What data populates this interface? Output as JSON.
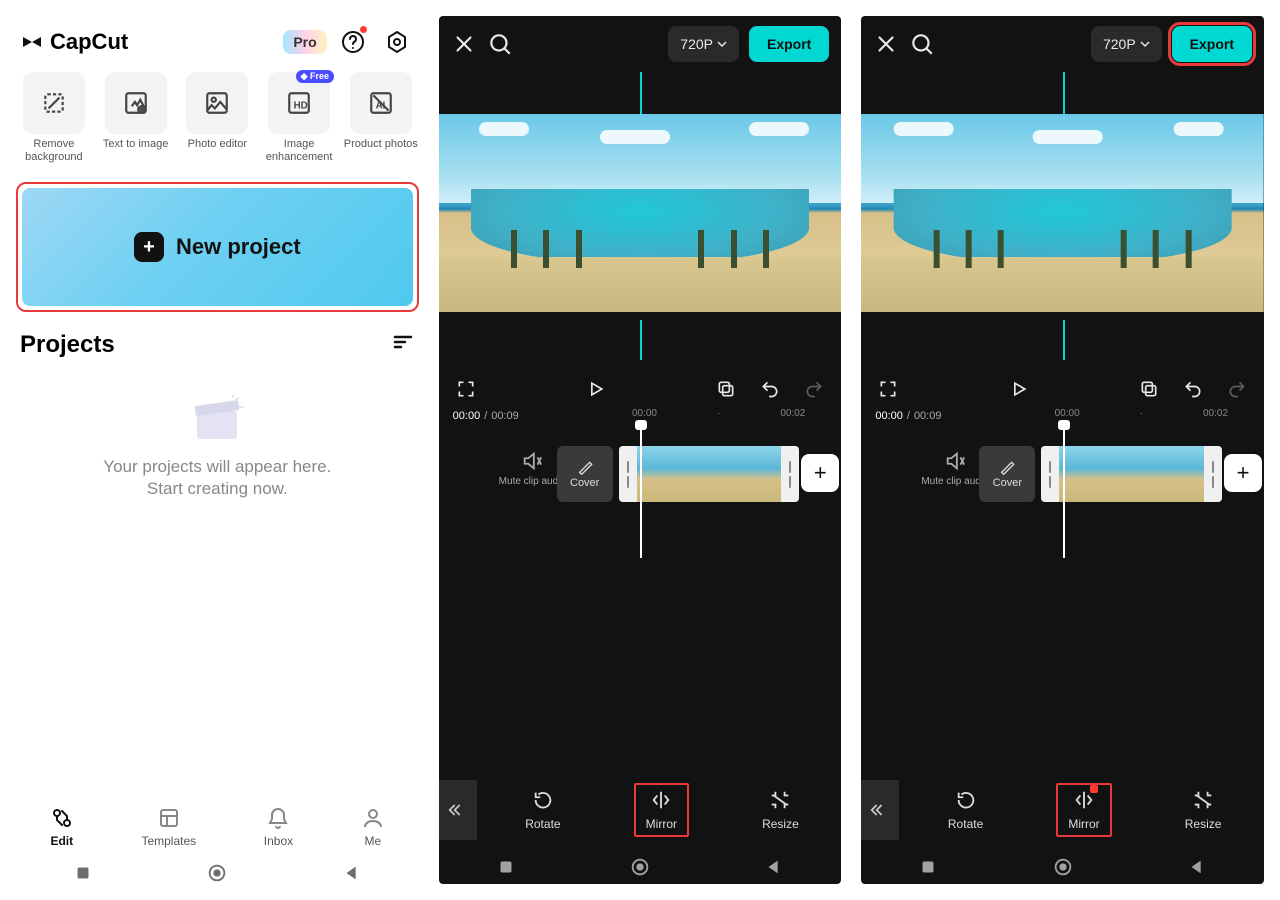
{
  "app": {
    "name": "CapCut",
    "pro_label": "Pro"
  },
  "home": {
    "tools": [
      {
        "label": "Remove background"
      },
      {
        "label": "Text to image"
      },
      {
        "label": "Photo editor"
      },
      {
        "label": "Image enhancement",
        "tag": "Free"
      },
      {
        "label": "Product photos"
      }
    ],
    "new_project": "New project",
    "projects_header": "Projects",
    "empty_line1": "Your projects will appear here.",
    "empty_line2": "Start creating now.",
    "tabs": [
      {
        "label": "Edit",
        "active": true
      },
      {
        "label": "Templates"
      },
      {
        "label": "Inbox"
      },
      {
        "label": "Me"
      }
    ]
  },
  "editor": {
    "resolution": "720P",
    "export_label": "Export",
    "time_current": "00:00",
    "time_total": "00:09",
    "marks": [
      "00:00",
      "00:02"
    ],
    "mute_label": "Mute clip audio",
    "cover_label": "Cover",
    "tools": [
      {
        "label": "Rotate"
      },
      {
        "label": "Mirror"
      },
      {
        "label": "Resize"
      }
    ]
  }
}
